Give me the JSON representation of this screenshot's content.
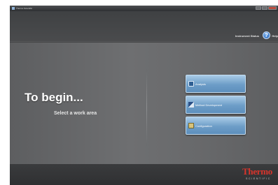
{
  "window": {
    "title": "Thermo Scientific"
  },
  "header": {
    "status_link": "Instrument Status",
    "help_label": "Help"
  },
  "main": {
    "heading": "To begin...",
    "subheading": "Select a work area",
    "buttons": [
      {
        "label": "Analysis",
        "icon": "analysis-icon"
      },
      {
        "label": "Method Development",
        "icon": "method-development-icon"
      },
      {
        "label": "Configuration",
        "icon": "configuration-icon"
      }
    ]
  },
  "footer": {
    "logo_word": "Thermo",
    "logo_sub": "SCIENTIFIC"
  },
  "colors": {
    "brand_red": "#d9342b",
    "button_blue": "#6d9dc7",
    "background_gray": "#68696b"
  }
}
